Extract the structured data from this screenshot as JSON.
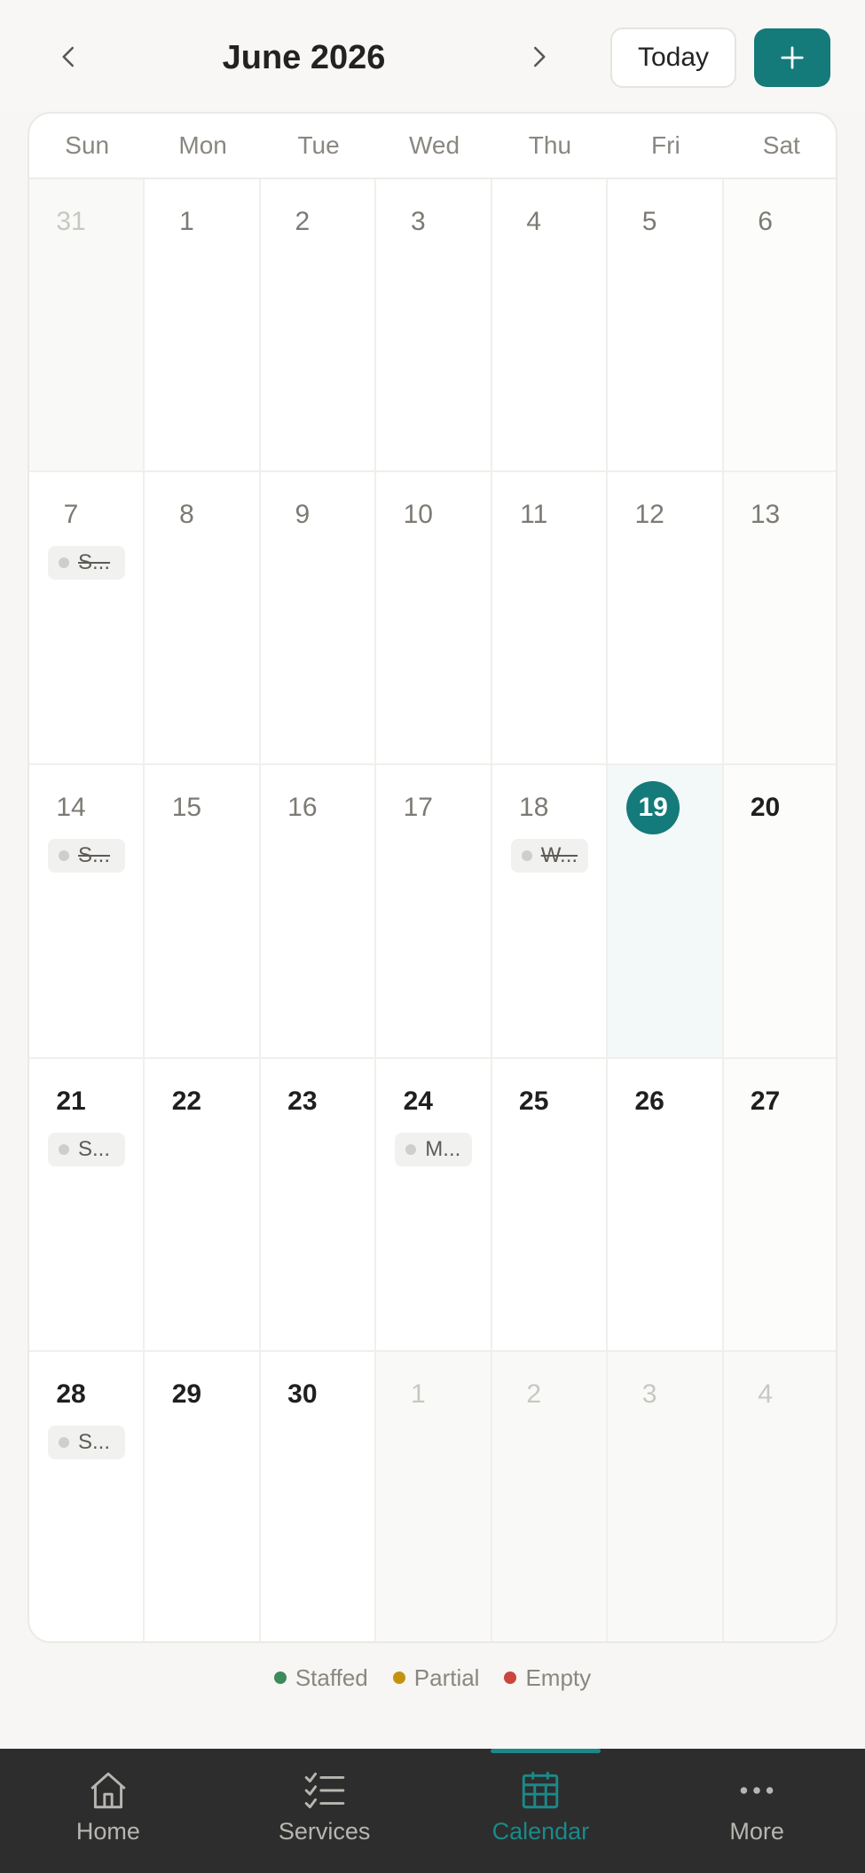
{
  "header": {
    "month_title": "June 2026",
    "today_label": "Today"
  },
  "weekdays": [
    "Sun",
    "Mon",
    "Tue",
    "Wed",
    "Thu",
    "Fri",
    "Sat"
  ],
  "weeks": [
    [
      {
        "day": "31",
        "state": "other"
      },
      {
        "day": "1",
        "state": "past"
      },
      {
        "day": "2",
        "state": "past"
      },
      {
        "day": "3",
        "state": "past"
      },
      {
        "day": "4",
        "state": "past"
      },
      {
        "day": "5",
        "state": "past"
      },
      {
        "day": "6",
        "state": "past"
      }
    ],
    [
      {
        "day": "7",
        "state": "past",
        "chip": {
          "text": "S...",
          "strike": true
        }
      },
      {
        "day": "8",
        "state": "past"
      },
      {
        "day": "9",
        "state": "past"
      },
      {
        "day": "10",
        "state": "past"
      },
      {
        "day": "11",
        "state": "past"
      },
      {
        "day": "12",
        "state": "past"
      },
      {
        "day": "13",
        "state": "past"
      }
    ],
    [
      {
        "day": "14",
        "state": "past",
        "chip": {
          "text": "S...",
          "strike": true
        }
      },
      {
        "day": "15",
        "state": "past"
      },
      {
        "day": "16",
        "state": "past"
      },
      {
        "day": "17",
        "state": "past"
      },
      {
        "day": "18",
        "state": "past",
        "chip": {
          "text": "W...",
          "strike": true
        }
      },
      {
        "day": "19",
        "state": "today"
      },
      {
        "day": "20",
        "state": "future"
      }
    ],
    [
      {
        "day": "21",
        "state": "future",
        "chip": {
          "text": "S...",
          "strike": false
        }
      },
      {
        "day": "22",
        "state": "future"
      },
      {
        "day": "23",
        "state": "future"
      },
      {
        "day": "24",
        "state": "future",
        "chip": {
          "text": "M...",
          "strike": false
        }
      },
      {
        "day": "25",
        "state": "future"
      },
      {
        "day": "26",
        "state": "future"
      },
      {
        "day": "27",
        "state": "future"
      }
    ],
    [
      {
        "day": "28",
        "state": "future",
        "chip": {
          "text": "S...",
          "strike": false
        }
      },
      {
        "day": "29",
        "state": "future"
      },
      {
        "day": "30",
        "state": "future"
      },
      {
        "day": "1",
        "state": "other"
      },
      {
        "day": "2",
        "state": "other"
      },
      {
        "day": "3",
        "state": "other"
      },
      {
        "day": "4",
        "state": "other"
      }
    ]
  ],
  "legend": [
    {
      "label": "Staffed",
      "color": "#3d8a5a"
    },
    {
      "label": "Partial",
      "color": "#c49213"
    },
    {
      "label": "Empty",
      "color": "#c9473d"
    }
  ],
  "tabs": [
    {
      "label": "Home",
      "icon": "home-icon",
      "active": false
    },
    {
      "label": "Services",
      "icon": "checklist-icon",
      "active": false
    },
    {
      "label": "Calendar",
      "icon": "calendar-icon",
      "active": true
    },
    {
      "label": "More",
      "icon": "more-dots-icon",
      "active": false
    }
  ],
  "colors": {
    "accent": "#147a7a",
    "tabbar_bg": "#2d2d2d"
  }
}
